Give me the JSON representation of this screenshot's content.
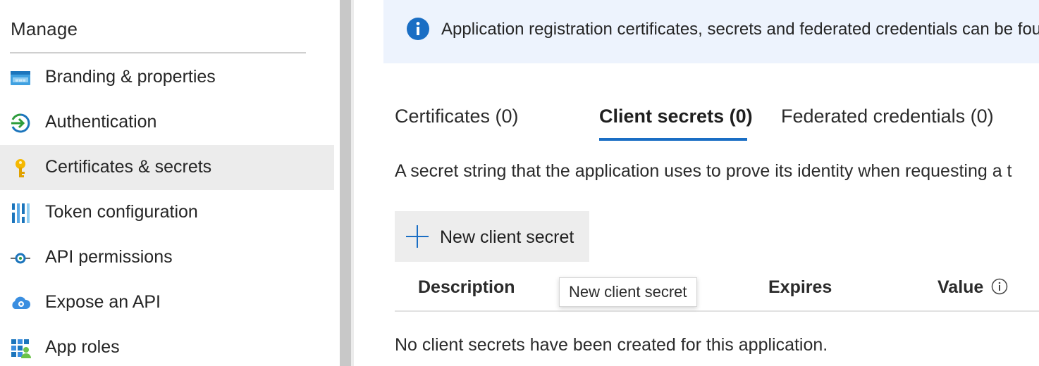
{
  "sidebar": {
    "section_title": "Manage",
    "items": [
      {
        "label": "Branding & properties",
        "icon": "branding-icon",
        "active": false
      },
      {
        "label": "Authentication",
        "icon": "authentication-icon",
        "active": false
      },
      {
        "label": "Certificates & secrets",
        "icon": "key-icon",
        "active": true
      },
      {
        "label": "Token configuration",
        "icon": "token-bars-icon",
        "active": false
      },
      {
        "label": "API permissions",
        "icon": "api-permissions-icon",
        "active": false
      },
      {
        "label": "Expose an API",
        "icon": "cloud-gear-icon",
        "active": false
      },
      {
        "label": "App roles",
        "icon": "app-roles-grid-icon",
        "active": false
      }
    ]
  },
  "main": {
    "info_banner": {
      "icon": "info-icon",
      "text": "Application registration certificates, secrets and federated credentials can be fou"
    },
    "tabs": [
      {
        "label": "Certificates (0)",
        "selected": false
      },
      {
        "label": "Client secrets (0)",
        "selected": true
      },
      {
        "label": "Federated credentials (0)",
        "selected": false
      }
    ],
    "description": "A secret string that the application uses to prove its identity when requesting a t",
    "new_secret_button": {
      "label": "New client secret",
      "icon": "plus-icon"
    },
    "table": {
      "columns": [
        "Description",
        "Expires",
        "Value"
      ],
      "value_info_icon": "info-circle-icon",
      "empty_message": "No client secrets have been created for this application."
    },
    "tooltip": "New client secret"
  },
  "colors": {
    "accent": "#1a6ec4",
    "banner_bg": "#edf3fd",
    "active_item_bg": "#ececec",
    "button_bg": "#ededed"
  }
}
